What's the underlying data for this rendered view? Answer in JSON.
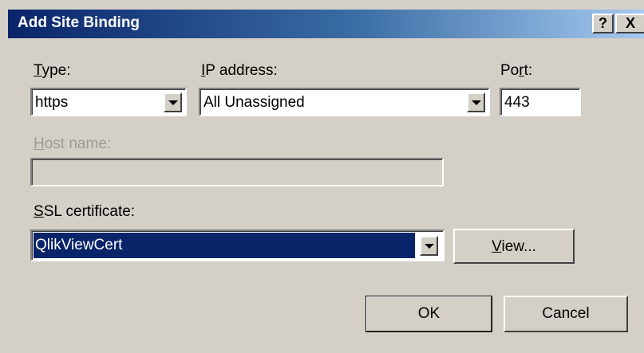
{
  "window": {
    "title": "Add Site Binding",
    "help_label": "?",
    "close_label": "X"
  },
  "type": {
    "label_prefix": "",
    "label_accel": "T",
    "label_rest": "ype:",
    "value": "https"
  },
  "ip_address": {
    "label_accel": "I",
    "label_rest": "P address:",
    "value": "All Unassigned"
  },
  "port": {
    "label_prefix": "Po",
    "label_accel": "r",
    "label_rest": "t:",
    "value": "443"
  },
  "host_name": {
    "label_accel": "H",
    "label_rest": "ost name:",
    "value": "",
    "enabled": false
  },
  "ssl_certificate": {
    "label_accel": "S",
    "label_rest": "SL certificate:",
    "value": "QlikViewCert"
  },
  "buttons": {
    "view_accel": "V",
    "view_rest": "iew...",
    "ok": "OK",
    "cancel": "Cancel"
  },
  "colors": {
    "dialog_bg": "#d4d0c8",
    "title_start": "#0a246a",
    "selection_bg": "#0a246a",
    "disabled_text": "#9d9a93"
  },
  "icons": [
    "dropdown-arrow-icon",
    "help-icon",
    "close-icon"
  ]
}
